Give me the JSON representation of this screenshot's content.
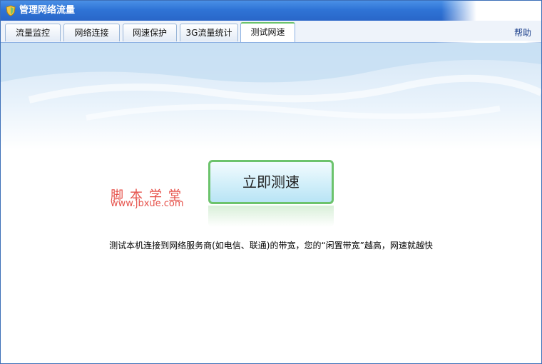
{
  "window": {
    "title": "管理网络流量"
  },
  "tabs": [
    {
      "label": "流量监控"
    },
    {
      "label": "网络连接"
    },
    {
      "label": "网速保护"
    },
    {
      "label": "3G流量统计"
    },
    {
      "label": "测试网速",
      "active": true
    }
  ],
  "help_label": "帮助",
  "speed_test": {
    "button_label": "立即测速",
    "description": "测试本机连接到网络服务商(如电信、联通)的带宽，您的“闲置带宽”越高，网速就越快"
  },
  "watermark": {
    "title": "脚本学堂",
    "url": "www.jbxue.com"
  },
  "colors": {
    "titlebar": "#2f74d6",
    "accent_green": "#6cc36c",
    "watermark": "#e6524b"
  }
}
